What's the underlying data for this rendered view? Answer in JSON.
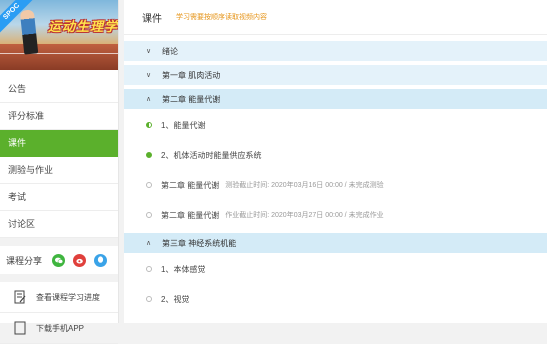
{
  "banner": {
    "badge": "SPOC",
    "course_art_title": "运动生理学"
  },
  "nav": {
    "items": [
      {
        "label": "公告",
        "active": false
      },
      {
        "label": "评分标准",
        "active": false
      },
      {
        "label": "课件",
        "active": true
      },
      {
        "label": "测验与作业",
        "active": false
      },
      {
        "label": "考试",
        "active": false
      },
      {
        "label": "讨论区",
        "active": false
      }
    ]
  },
  "share": {
    "label": "课程分享",
    "icons": [
      "wechat-icon",
      "weibo-icon",
      "qq-icon"
    ]
  },
  "tools": [
    {
      "label": "查看课程学习进度",
      "icon": "progress-icon"
    },
    {
      "label": "下载手机APP",
      "icon": "phone-icon"
    }
  ],
  "main": {
    "title": "课件",
    "hint": "学习需要按顺序读取视频内容",
    "chapters": [
      {
        "label": "绪论",
        "expanded": false
      },
      {
        "label": "第一章 肌肉活动",
        "expanded": false
      },
      {
        "label": "第二章 能量代谢",
        "expanded": true
      },
      {
        "label": "第三章 神经系统机能",
        "expanded": true
      }
    ],
    "lessons_ch2": [
      {
        "label": "1、能量代谢",
        "status": "half",
        "meta": ""
      },
      {
        "label": "2、机体活动时能量供应系统",
        "status": "full",
        "meta": ""
      },
      {
        "label": "第二章 能量代谢",
        "status": "none",
        "meta": "测验截止时间: 2020年03月16日 00:00 / 未完成测验"
      },
      {
        "label": "第二章 能量代谢",
        "status": "none",
        "meta": "作业截止时间: 2020年03月27日 00:00 / 未完成作业"
      }
    ],
    "lessons_ch3": [
      {
        "label": "1、本体感觉",
        "status": "none",
        "meta": ""
      },
      {
        "label": "2、视觉",
        "status": "none",
        "meta": ""
      }
    ]
  }
}
